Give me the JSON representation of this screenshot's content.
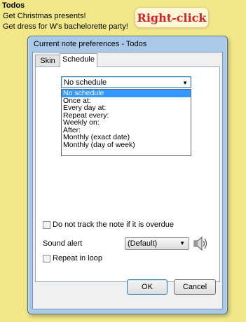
{
  "note": {
    "title": "Todos",
    "lines": [
      "Get Christmas presents!",
      "Get dress for W's bachelorette party!"
    ],
    "callout": "Right-click"
  },
  "dialog": {
    "title": "Current note preferences - Todos",
    "tabs": [
      {
        "label": "Skin",
        "active": false
      },
      {
        "label": "Schedule",
        "active": true
      }
    ],
    "schedule": {
      "selected": "No schedule",
      "options": [
        "No schedule",
        "Once at:",
        "Every day at:",
        "Repeat every:",
        "Weekly on:",
        "After:",
        "Monthly (exact date)",
        "Monthly (day of week)"
      ]
    },
    "overdue_label": "Do not track the note if it is overdue",
    "sound_alert_label": "Sound alert",
    "sound_value": "(Default)",
    "repeat_label": "Repeat in loop",
    "ok": "OK",
    "cancel": "Cancel"
  },
  "icons": {
    "speaker": "speaker-icon",
    "dropdown": "chevron-down-icon"
  },
  "colors": {
    "note_bg": "#f2e88a",
    "selection": "#3399ff",
    "callout_text": "#d2232a"
  }
}
